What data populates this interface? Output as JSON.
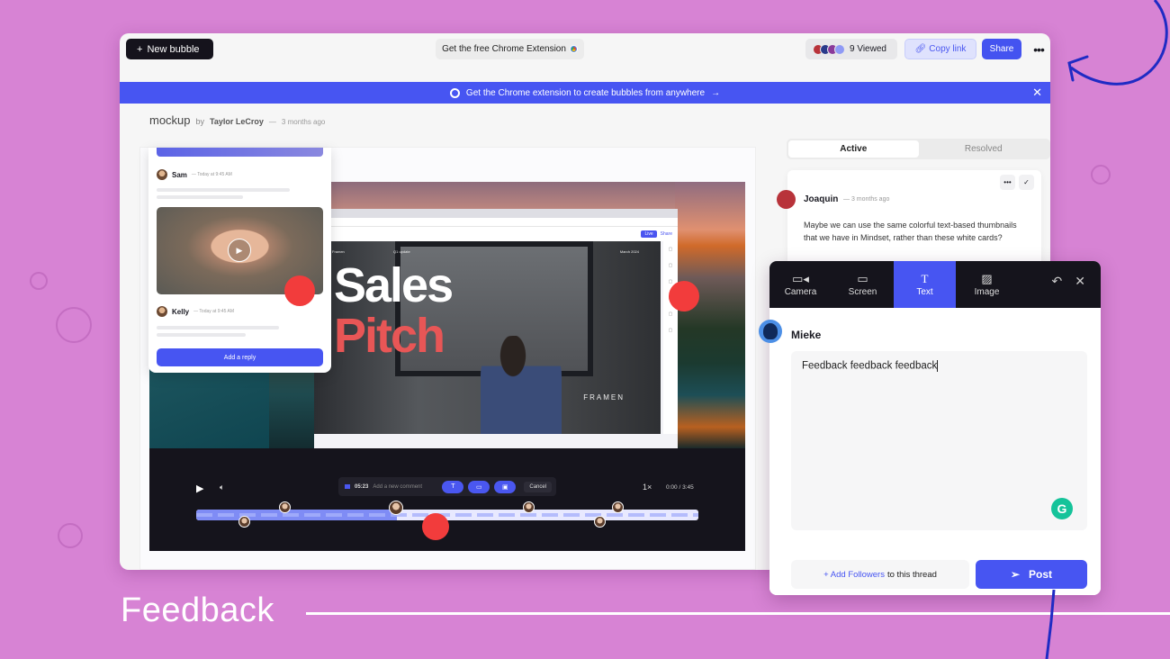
{
  "caption": "Feedback",
  "topbar": {
    "new_bubble_label": "New bubble",
    "extension_label": "Get the free Chrome Extension",
    "viewed_label": "9 Viewed",
    "copy_link_label": "Copy link",
    "share_label": "Share",
    "more_label": "•••"
  },
  "banner": {
    "text": "Get the Chrome extension to create bubbles from anywhere",
    "arrow": "→",
    "close": "✕"
  },
  "bubble": {
    "title": "mockup",
    "by": "by",
    "author": "Taylor LeCroy",
    "separator": "—",
    "age": "3 months ago"
  },
  "thread_popup": {
    "replies": [
      {
        "name": "Sam",
        "time": "— Today at 9:45 AM"
      },
      {
        "name": "Kelly",
        "time": "— Today at 9:45 AM"
      }
    ],
    "reply_button": "Add a reply"
  },
  "slide": {
    "header_left": "Framen",
    "header_mid": "Q1 update",
    "header_right": "March 2024",
    "title_line1": "Sales",
    "title_line2": "Pitch",
    "brand": "FRAMEN",
    "live_label": "Live",
    "share_label": "Share"
  },
  "player": {
    "comment_time": "05:23",
    "comment_placeholder": "Add a new comment",
    "cancel_label": "Cancel",
    "speed": "1×",
    "current_time": "0:00",
    "time_sep": "/",
    "duration": "3:45",
    "progress": 0.4
  },
  "comments_panel": {
    "tabs": [
      {
        "label": "Active",
        "active": true
      },
      {
        "label": "Resolved",
        "active": false
      }
    ],
    "comment": {
      "author": "Joaquin",
      "age": "— 3 months ago",
      "body": "Maybe we can use the same colorful text-based thumbnails that we have in Mindset, rather than these white cards?"
    }
  },
  "composer": {
    "tabs": [
      {
        "label": "Camera",
        "icon": "camera-icon",
        "active": false
      },
      {
        "label": "Screen",
        "icon": "screen-icon",
        "active": false
      },
      {
        "label": "Text",
        "icon": "text-icon",
        "active": true
      },
      {
        "label": "Image",
        "icon": "image-icon",
        "active": false
      }
    ],
    "user": "Mieke",
    "text_value": "Feedback feedback feedback",
    "add_followers_link": "+ Add Followers",
    "add_followers_suffix": "to this thread",
    "post_label": "Post"
  },
  "colors": {
    "background": "#d783d4",
    "accent": "#4755f2",
    "dark": "#15141c",
    "marker_red": "#f23c3c",
    "arrow": "#1f2bc4"
  }
}
